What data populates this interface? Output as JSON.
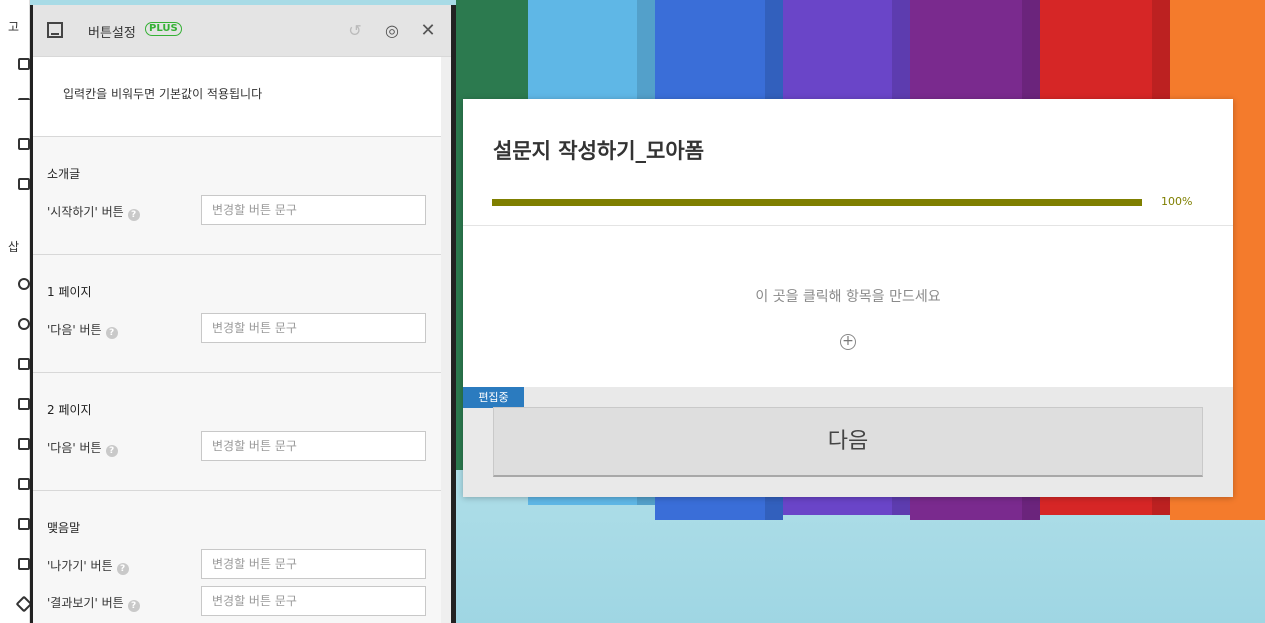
{
  "left_strip": {
    "label_top": "고",
    "label_insert": "삽"
  },
  "panel": {
    "title": "버튼설정",
    "plus_badge": "PLUS",
    "note": "입력칸을 비워두면 기본값이 적용됩니다",
    "sections": [
      {
        "title": "소개글",
        "rows": [
          {
            "label": "'시작하기' 버튼",
            "placeholder": "변경할 버튼 문구"
          }
        ]
      },
      {
        "title": "1 페이지",
        "rows": [
          {
            "label": "'다음' 버튼",
            "placeholder": "변경할 버튼 문구"
          }
        ]
      },
      {
        "title": "2 페이지",
        "rows": [
          {
            "label": "'다음' 버튼",
            "placeholder": "변경할 버튼 문구"
          }
        ]
      },
      {
        "title": "맺음말",
        "rows": [
          {
            "label": "'나가기' 버튼",
            "placeholder": "변경할 버튼 문구"
          },
          {
            "label": "'결과보기' 버튼",
            "placeholder": "변경할 버튼 문구"
          }
        ]
      }
    ],
    "help_glyph": "?"
  },
  "card": {
    "title": "설문지 작성하기_모아폼",
    "progress_percent": 100,
    "progress_label": "100%",
    "progress_color": "#7f7f00",
    "empty_hint": "이 곳을 클릭해 항목을 만드세요",
    "editing_badge": "편집중",
    "next_button": "다음"
  }
}
